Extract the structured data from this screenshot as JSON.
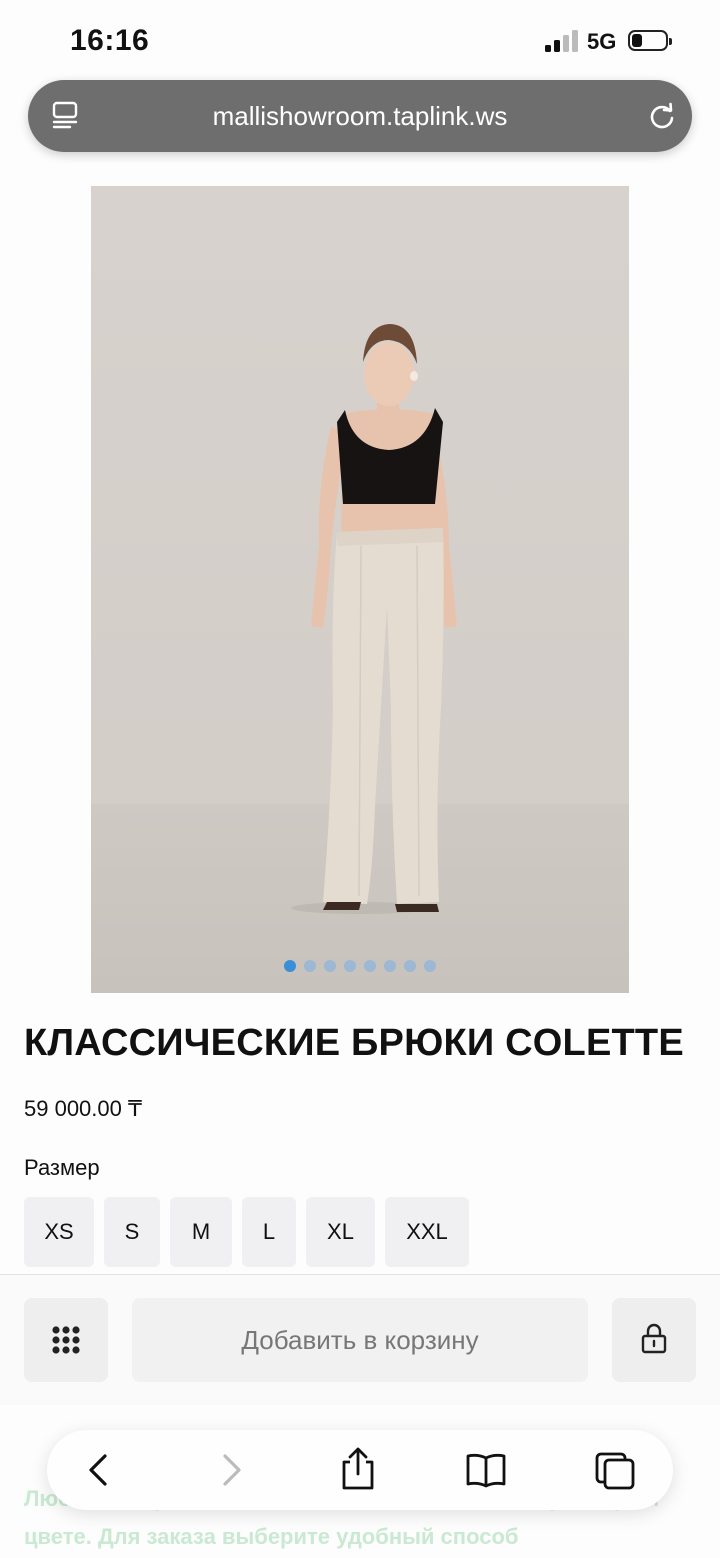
{
  "status_bar": {
    "time": "16:16",
    "network": "5G"
  },
  "browser": {
    "url": "mallishowroom.taplink.ws"
  },
  "gallery": {
    "image_count": 8,
    "active_index": 0
  },
  "product": {
    "title": "КЛАССИЧЕСКИЕ БРЮКИ COLETTE",
    "price": "59 000.00 ₸",
    "size_label": "Размер",
    "sizes": [
      "XS",
      "S",
      "M",
      "L",
      "XL",
      "XXL"
    ]
  },
  "cart": {
    "add_label": "Добавить в корзину"
  },
  "description": {
    "text": "Любой товар можно заказать в желаемом вами размере и цвете. Для заказа выберите удобный способ"
  },
  "colors": {
    "accent": "#3a8fd8",
    "button_bg": "#f0f0f2"
  }
}
